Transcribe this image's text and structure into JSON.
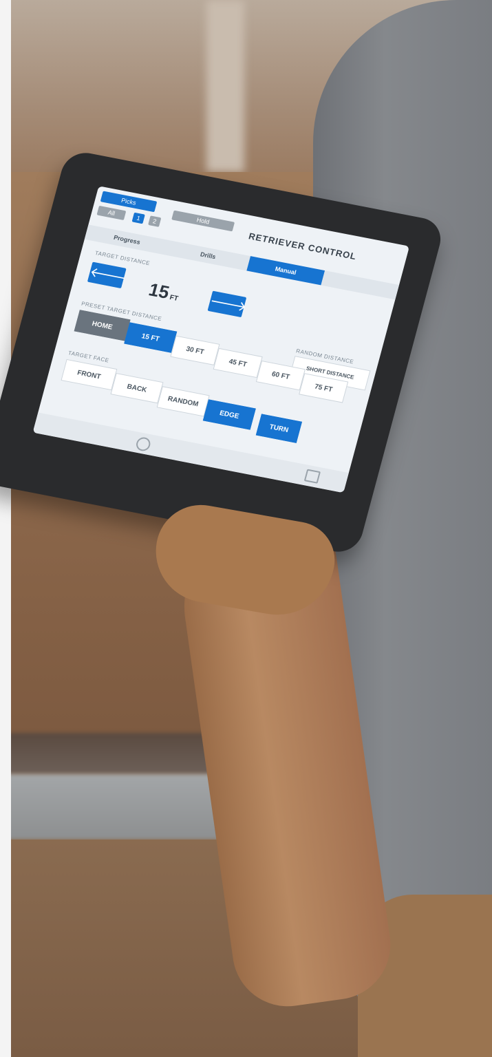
{
  "scene": {
    "description_free": true
  },
  "tablet_ui": {
    "top_buttons": {
      "primary": "Picks",
      "secondary1": "All",
      "secondary2": "1",
      "secondary3": "2",
      "grey_wide": "Hold"
    },
    "title": "RETRIEVER CONTROL",
    "subtabs": [
      "Progress",
      "Drills",
      "Manual"
    ],
    "active_subtab": "Manual",
    "target_distance_label": "TARGET DISTANCE",
    "distance_value": "15",
    "distance_unit": "FT",
    "left_arrow": "🡐",
    "right_arrow": "🡒",
    "preset_label": "PRESET TARGET DISTANCE",
    "random_distance_label": "RANDOM DISTANCE",
    "short_distance": "SHORT DISTANCE",
    "presets": [
      "HOME",
      "15 FT",
      "30 FT",
      "45 FT",
      "60 FT",
      "75 FT"
    ],
    "selected_preset": "15 FT",
    "target_face_label": "TARGET FACE",
    "faces": [
      "FRONT",
      "BACK",
      "RANDOM",
      "EDGE"
    ],
    "selected_face": "EDGE",
    "turn_label": "TURN"
  },
  "colors": {
    "accent": "#1774d1",
    "home_bg": "#6a747e",
    "screen_bg": "#eef2f6"
  },
  "icons": [
    "clock-icon",
    "map-icon"
  ]
}
